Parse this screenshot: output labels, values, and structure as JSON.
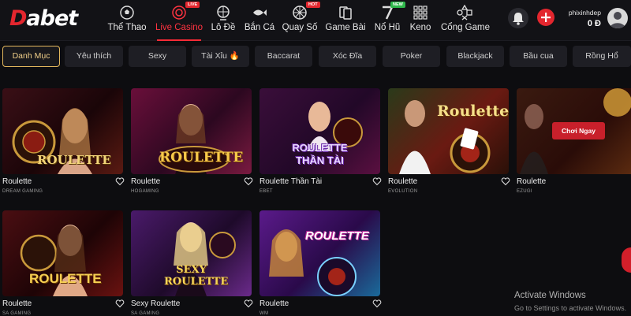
{
  "brand": {
    "logo_first": "D",
    "logo_rest": "abet",
    "accent": "#e3262e"
  },
  "nav": [
    {
      "label": "Thể Thao",
      "icon": "soccer-ball-icon",
      "badge": null
    },
    {
      "label": "Live Casino",
      "icon": "casino-chip-icon",
      "badge": "LIVE",
      "active": true
    },
    {
      "label": "Lô Đề",
      "icon": "lottery-wheel-icon",
      "badge": null
    },
    {
      "label": "Bắn Cá",
      "icon": "fish-icon",
      "badge": null
    },
    {
      "label": "Quay Số",
      "icon": "lucky-wheel-icon",
      "badge": "HOT"
    },
    {
      "label": "Game Bài",
      "icon": "playing-cards-icon",
      "badge": null
    },
    {
      "label": "Nổ Hũ",
      "icon": "slot-seven-icon",
      "badge": "NEW"
    },
    {
      "label": "Keno",
      "icon": "keno-grid-icon",
      "badge": null
    },
    {
      "label": "Cổng Game",
      "icon": "gamepad-shapes-icon",
      "badge": null
    }
  ],
  "user": {
    "name": "phixinhdep",
    "balance": "0 Đ"
  },
  "categories": [
    "Danh Mục",
    "Yêu thích",
    "Sexy",
    "Tài Xỉu 🔥",
    "Baccarat",
    "Xóc Đĩa",
    "Poker",
    "Blackjack",
    "Bầu cua",
    "Rồng Hổ"
  ],
  "games_row1": [
    {
      "title": "Roulette",
      "provider": "DREAM GAMING",
      "thumb_text": "ROULETTE"
    },
    {
      "title": "Roulette",
      "provider": "HOGAMING",
      "thumb_text": "ROULETTE"
    },
    {
      "title": "Roulette Thần Tài",
      "provider": "EBET",
      "thumb_text": "ROULETTE THẦN TÀI"
    },
    {
      "title": "Roulette",
      "provider": "EVOLUTION",
      "thumb_text": "Roulette"
    },
    {
      "title": "Roulette",
      "provider": "EZUGI",
      "thumb_text": ""
    }
  ],
  "games_row2": [
    {
      "title": "Roulette",
      "provider": "SA GAMING",
      "thumb_text": "ROULETTE"
    },
    {
      "title": "Sexy Roulette",
      "provider": "SA GAMING",
      "thumb_text": "SEXY ROULETTE"
    },
    {
      "title": "Roulette",
      "provider": "WM",
      "thumb_text": "ROULETTE"
    }
  ],
  "play_button": "Chơi Ngay",
  "windows": {
    "title": "Activate Windows",
    "subtitle": "Go to Settings to activate Windows."
  }
}
